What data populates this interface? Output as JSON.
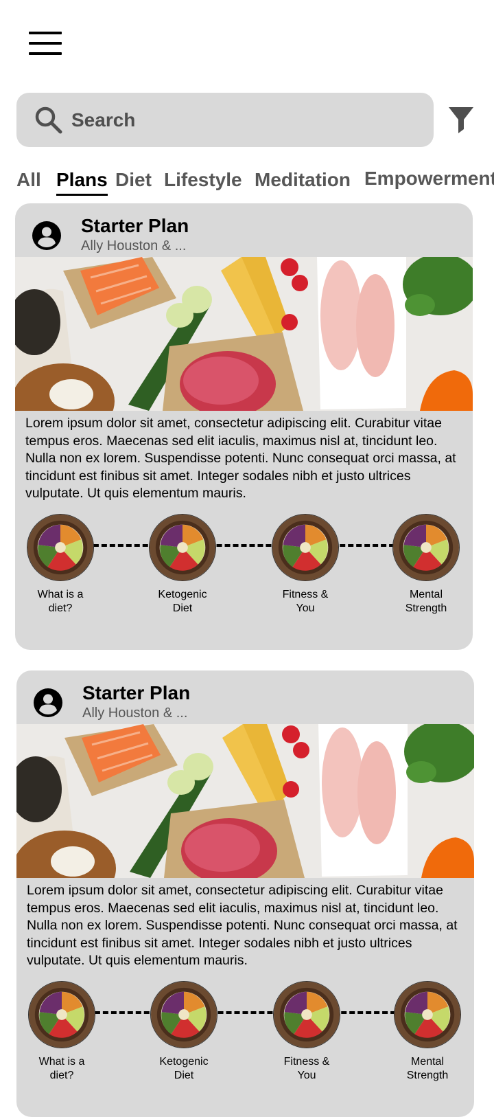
{
  "search": {
    "placeholder": "Search"
  },
  "tabs": [
    {
      "label": "All"
    },
    {
      "label": "Plans",
      "active": true
    },
    {
      "label": "Diet"
    },
    {
      "label": "Lifestyle"
    },
    {
      "label": "Meditation"
    },
    {
      "label": "Empowerment"
    }
  ],
  "cards": [
    {
      "title": "Starter Plan",
      "subtitle": "Ally Houston & ...",
      "description": "Lorem ipsum dolor sit amet, consectetur adipiscing elit. Curabitur vitae tempus eros. Maecenas sed elit iaculis, maximus nisl at, tincidunt leo. Nulla non ex lorem. Suspendisse potenti. Nunc consequat orci massa, at tincidunt est finibus sit amet. Integer sodales nibh et justo ultrices vulputate. Ut quis elementum mauris.",
      "steps": [
        {
          "label": "What is a\ndiet?"
        },
        {
          "label": "Ketogenic\nDiet"
        },
        {
          "label": "Fitness &\nYou"
        },
        {
          "label": "Mental\nStrength"
        }
      ]
    },
    {
      "title": "Starter Plan",
      "subtitle": "Ally Houston & ...",
      "description": "Lorem ipsum dolor sit amet, consectetur adipiscing elit. Curabitur vitae tempus eros. Maecenas sed elit iaculis, maximus nisl at, tincidunt leo. Nulla non ex lorem. Suspendisse potenti. Nunc consequat orci massa, at tincidunt est finibus sit amet. Integer sodales nibh et justo ultrices vulputate. Ut quis elementum mauris.",
      "steps": [
        {
          "label": "What is a\ndiet?"
        },
        {
          "label": "Ketogenic\nDiet"
        },
        {
          "label": "Fitness &\nYou"
        },
        {
          "label": "Mental\nStrength"
        }
      ]
    }
  ],
  "icons": {
    "menu": "hamburger-menu-icon",
    "search": "search-icon",
    "filter": "filter-icon",
    "avatar": "user-avatar-icon"
  },
  "colors": {
    "surface": "#d9d9d9",
    "text": "#000000",
    "muted": "#575757"
  }
}
